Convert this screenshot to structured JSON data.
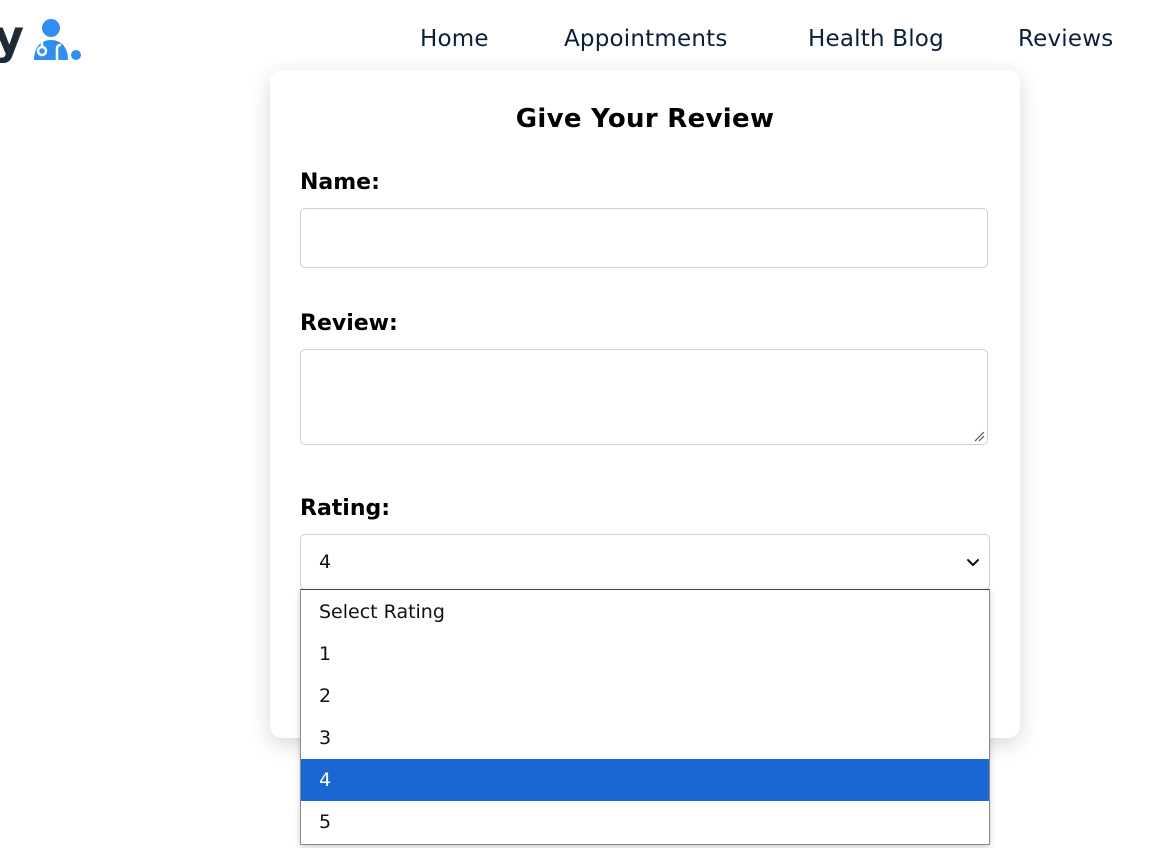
{
  "header": {
    "logo_letter": "y",
    "nav": [
      {
        "label": "Home"
      },
      {
        "label": "Appointments"
      },
      {
        "label": "Health Blog"
      },
      {
        "label": "Reviews"
      }
    ]
  },
  "form": {
    "title": "Give Your Review",
    "name_label": "Name:",
    "name_value": "",
    "review_label": "Review:",
    "review_value": "",
    "rating_label": "Rating:",
    "rating_selected": "4"
  },
  "dropdown": {
    "options": [
      "Select Rating",
      "1",
      "2",
      "3",
      "4",
      "5"
    ],
    "selected_index": 4
  },
  "colors": {
    "brand_blue": "#2f8ef0",
    "nav_text": "#0b1f3a",
    "selected_option_bg": "#1a66d2"
  },
  "icons": {
    "logo": "doctor-icon",
    "select_arrow": "chevron-down-icon",
    "textarea_resize": "resize-handle-icon"
  }
}
